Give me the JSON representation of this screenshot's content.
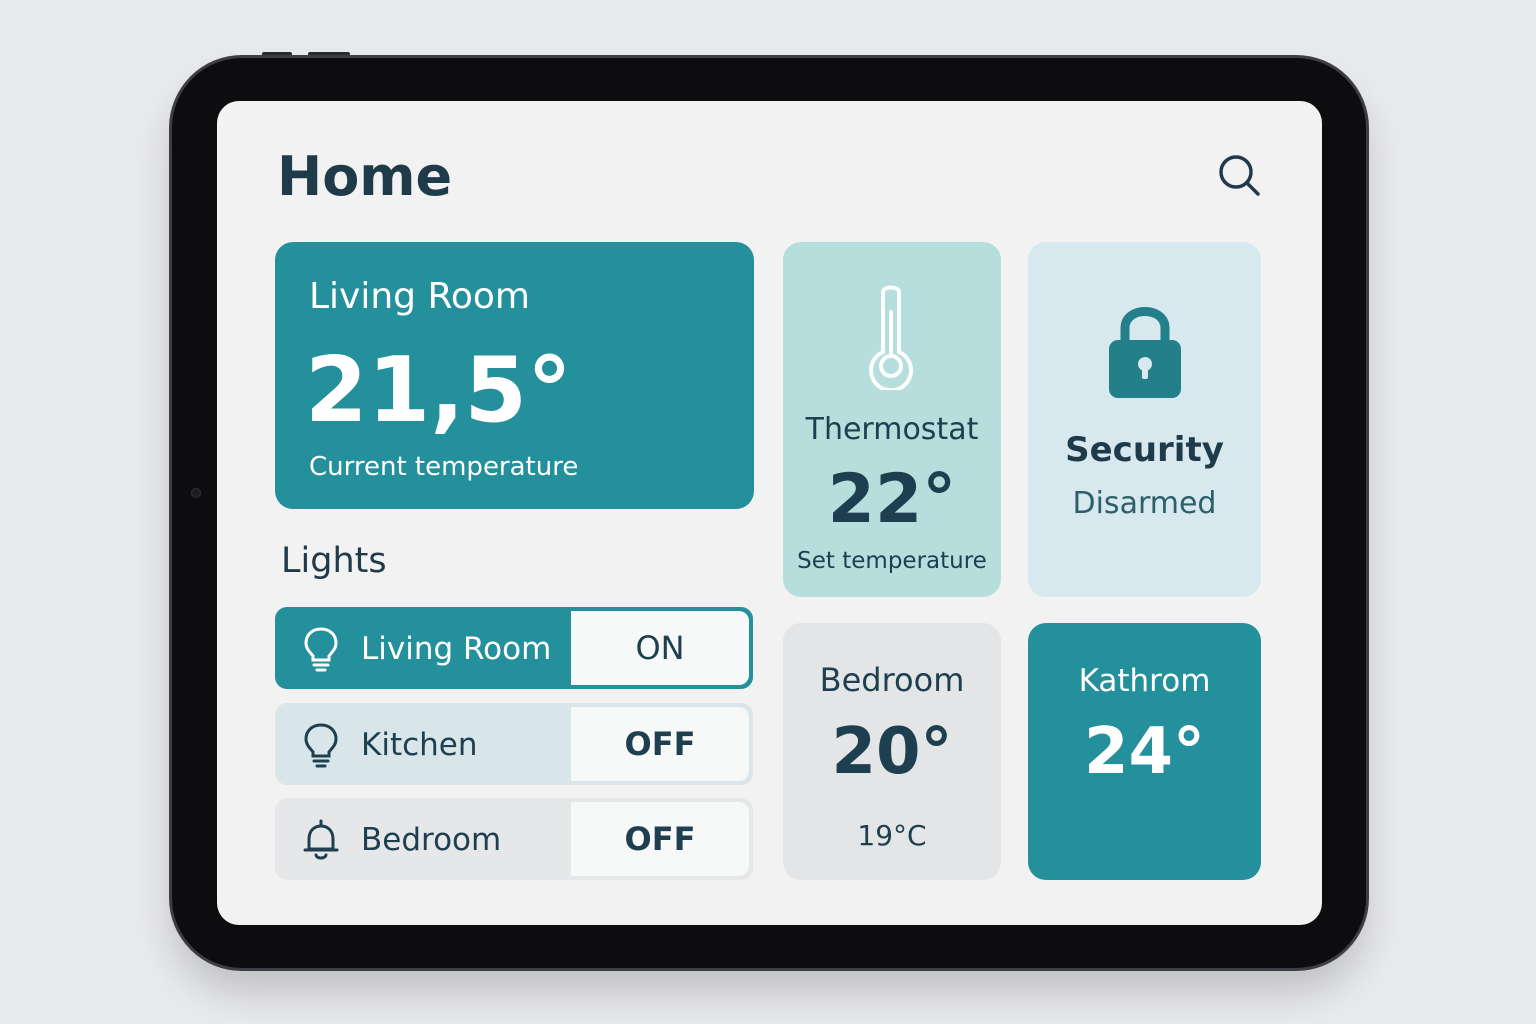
{
  "header": {
    "title": "Home",
    "search_icon": "search-icon"
  },
  "living_room_card": {
    "name": "Living Room",
    "temperature": "21,5°",
    "label": "Current temperature"
  },
  "lights": {
    "heading": "Lights",
    "items": [
      {
        "label": "Living Room",
        "state": "ON",
        "icon": "lightbulb-icon"
      },
      {
        "label": "Kitchen",
        "state": "OFF",
        "icon": "lightbulb-icon"
      },
      {
        "label": "Bedroom",
        "state": "OFF",
        "icon": "bell-icon"
      }
    ]
  },
  "thermostat": {
    "name": "Thermostat",
    "temperature": "22°",
    "label": "Set temperature",
    "icon": "thermometer-icon"
  },
  "security": {
    "name": "Security",
    "status": "Disarmed",
    "icon": "lock-icon"
  },
  "bedroom_card": {
    "name": "Bedroom",
    "temperature": "20°",
    "secondary": "19°C"
  },
  "bathroom_card": {
    "name": "Kathrom",
    "temperature": "24°"
  },
  "colors": {
    "accent": "#23909b",
    "text_dark": "#1f3b4a",
    "thermo_bg": "#b5dedd",
    "security_bg": "#d7e9ee"
  }
}
